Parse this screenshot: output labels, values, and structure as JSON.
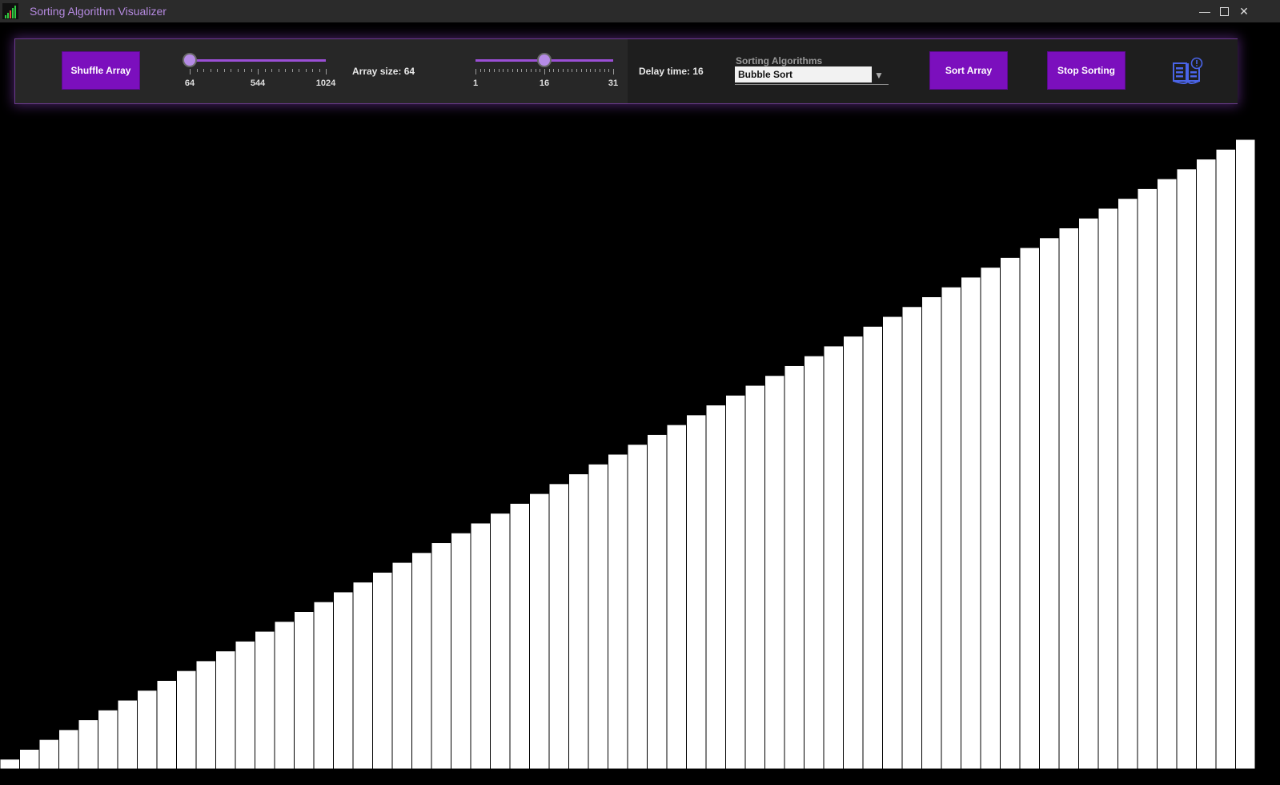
{
  "window": {
    "title": "Sorting Algorithm Visualizer",
    "controls": [
      "minimize-icon",
      "maximize-icon",
      "close-icon"
    ]
  },
  "toolbar": {
    "shuffle_label": "Shuffle Array",
    "array_size_label": "Array size: 64",
    "size_slider": {
      "min": 64,
      "max": 1024,
      "value": 64,
      "tick_labels": [
        "64",
        "544",
        "1024"
      ]
    },
    "delay_slider": {
      "min": 1,
      "max": 31,
      "value": 16,
      "tick_labels": [
        "1",
        "16",
        "31"
      ]
    },
    "delay_label": "Delay time: 16",
    "algorithms_caption": "Sorting Algorithms",
    "algorithm_selected": "Bubble Sort",
    "sort_label": "Sort Array",
    "stop_label": "Stop Sorting",
    "help_icon": "book-info-icon"
  },
  "colors": {
    "accent": "#7b0fbd",
    "slider": "#9b4fd6",
    "title_text": "#b58ae0",
    "bar": "#ffffff",
    "background": "#000000"
  },
  "visualizer": {
    "bar_count": 64,
    "values": [
      1,
      2,
      3,
      4,
      5,
      6,
      7,
      8,
      9,
      10,
      11,
      12,
      13,
      14,
      15,
      16,
      17,
      18,
      19,
      20,
      21,
      22,
      23,
      24,
      25,
      26,
      27,
      28,
      29,
      30,
      31,
      32,
      33,
      34,
      35,
      36,
      37,
      38,
      39,
      40,
      41,
      42,
      43,
      44,
      45,
      46,
      47,
      48,
      49,
      50,
      51,
      52,
      53,
      54,
      55,
      56,
      57,
      58,
      59,
      60,
      61,
      62,
      63,
      64
    ]
  }
}
